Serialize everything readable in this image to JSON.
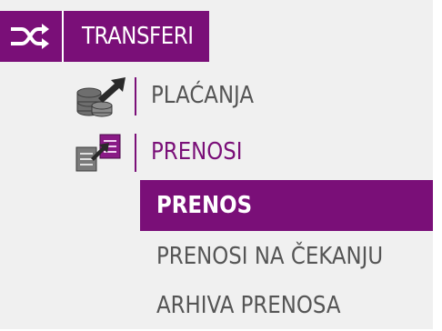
{
  "menu": {
    "header": {
      "icon": "shuffle-icon",
      "title": "TRANSFERI"
    },
    "items": [
      {
        "label": "PLAĆANJA",
        "icon": "coins-arrow-icon"
      },
      {
        "label": "PRENOSI",
        "icon": "documents-arrow-icon"
      }
    ],
    "subitems": [
      {
        "label": "PRENOS",
        "active": true
      },
      {
        "label": "PRENOSI NA ČEKANJU",
        "active": false
      },
      {
        "label": "ARHIVA PRENOSA",
        "active": false
      }
    ]
  },
  "colors": {
    "accent": "#7a0f78",
    "text": "#555555",
    "background": "#f0f0f0"
  }
}
